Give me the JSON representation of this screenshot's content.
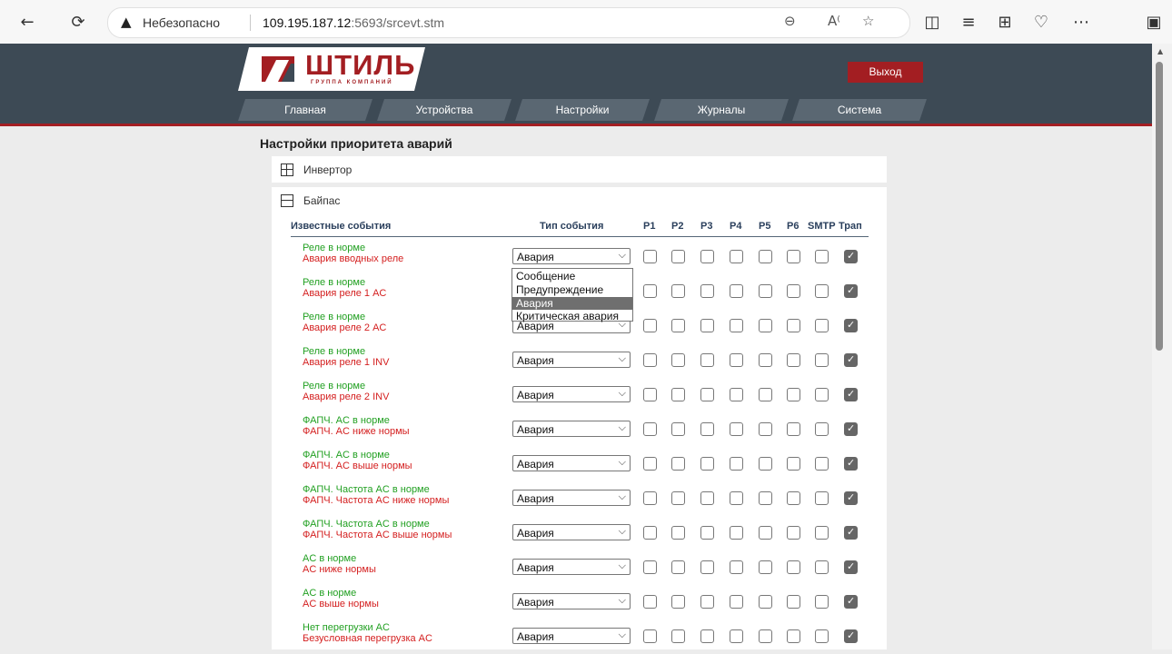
{
  "browser": {
    "security_label": "Небезопасно",
    "url_host": "109.195.187.12",
    "url_rest": ":5693/srcevt.stm"
  },
  "header": {
    "logo_text": "ШТИЛЬ",
    "logo_sub": "ГРУППА КОМПАНИЙ",
    "logout": "Выход",
    "nav": [
      "Главная",
      "Устройства",
      "Настройки",
      "Журналы",
      "Система"
    ]
  },
  "page": {
    "title": "Настройки приоритета аварий",
    "panels": [
      "Инвертор",
      "Байпас"
    ]
  },
  "table": {
    "col_events": "Известные события",
    "col_type": "Тип события",
    "col_flags": [
      "P1",
      "P2",
      "P3",
      "P4",
      "P5",
      "P6",
      "SMTP",
      "Трап"
    ],
    "rows": [
      {
        "ok": "Реле в норме",
        "alarm": "Авария вводных реле",
        "type": "Авария"
      },
      {
        "ok": "Реле в норме",
        "alarm": "Авария реле 1 AC",
        "type": "Авария"
      },
      {
        "ok": "Реле в норме",
        "alarm": "Авария реле 2 AC",
        "type": "Авария"
      },
      {
        "ok": "Реле в норме",
        "alarm": "Авария реле 1 INV",
        "type": "Авария"
      },
      {
        "ok": "Реле в норме",
        "alarm": "Авария реле 2 INV",
        "type": "Авария"
      },
      {
        "ok": "ФАПЧ. AC в норме",
        "alarm": "ФАПЧ. AC ниже нормы",
        "type": "Авария"
      },
      {
        "ok": "ФАПЧ. AC в норме",
        "alarm": "ФАПЧ. AC выше нормы",
        "type": "Авария"
      },
      {
        "ok": "ФАПЧ. Частота AC в норме",
        "alarm": "ФАПЧ. Частота AC ниже нормы",
        "type": "Авария"
      },
      {
        "ok": "ФАПЧ. Частота AC в норме",
        "alarm": "ФАПЧ. Частота AC выше нормы",
        "type": "Авария"
      },
      {
        "ok": "AC в норме",
        "alarm": "AC ниже нормы",
        "type": "Авария"
      },
      {
        "ok": "AC в норме",
        "alarm": "AC выше нормы",
        "type": "Авария"
      },
      {
        "ok": "Нет перегрузки AC",
        "alarm": "Безусловная перегрузка AC",
        "type": "Авария"
      }
    ],
    "checked_flag": "Трап"
  },
  "dropdown": {
    "options": [
      "Сообщение",
      "Предупреждение",
      "Авария",
      "Критическая авария"
    ],
    "highlighted": "Авария"
  }
}
